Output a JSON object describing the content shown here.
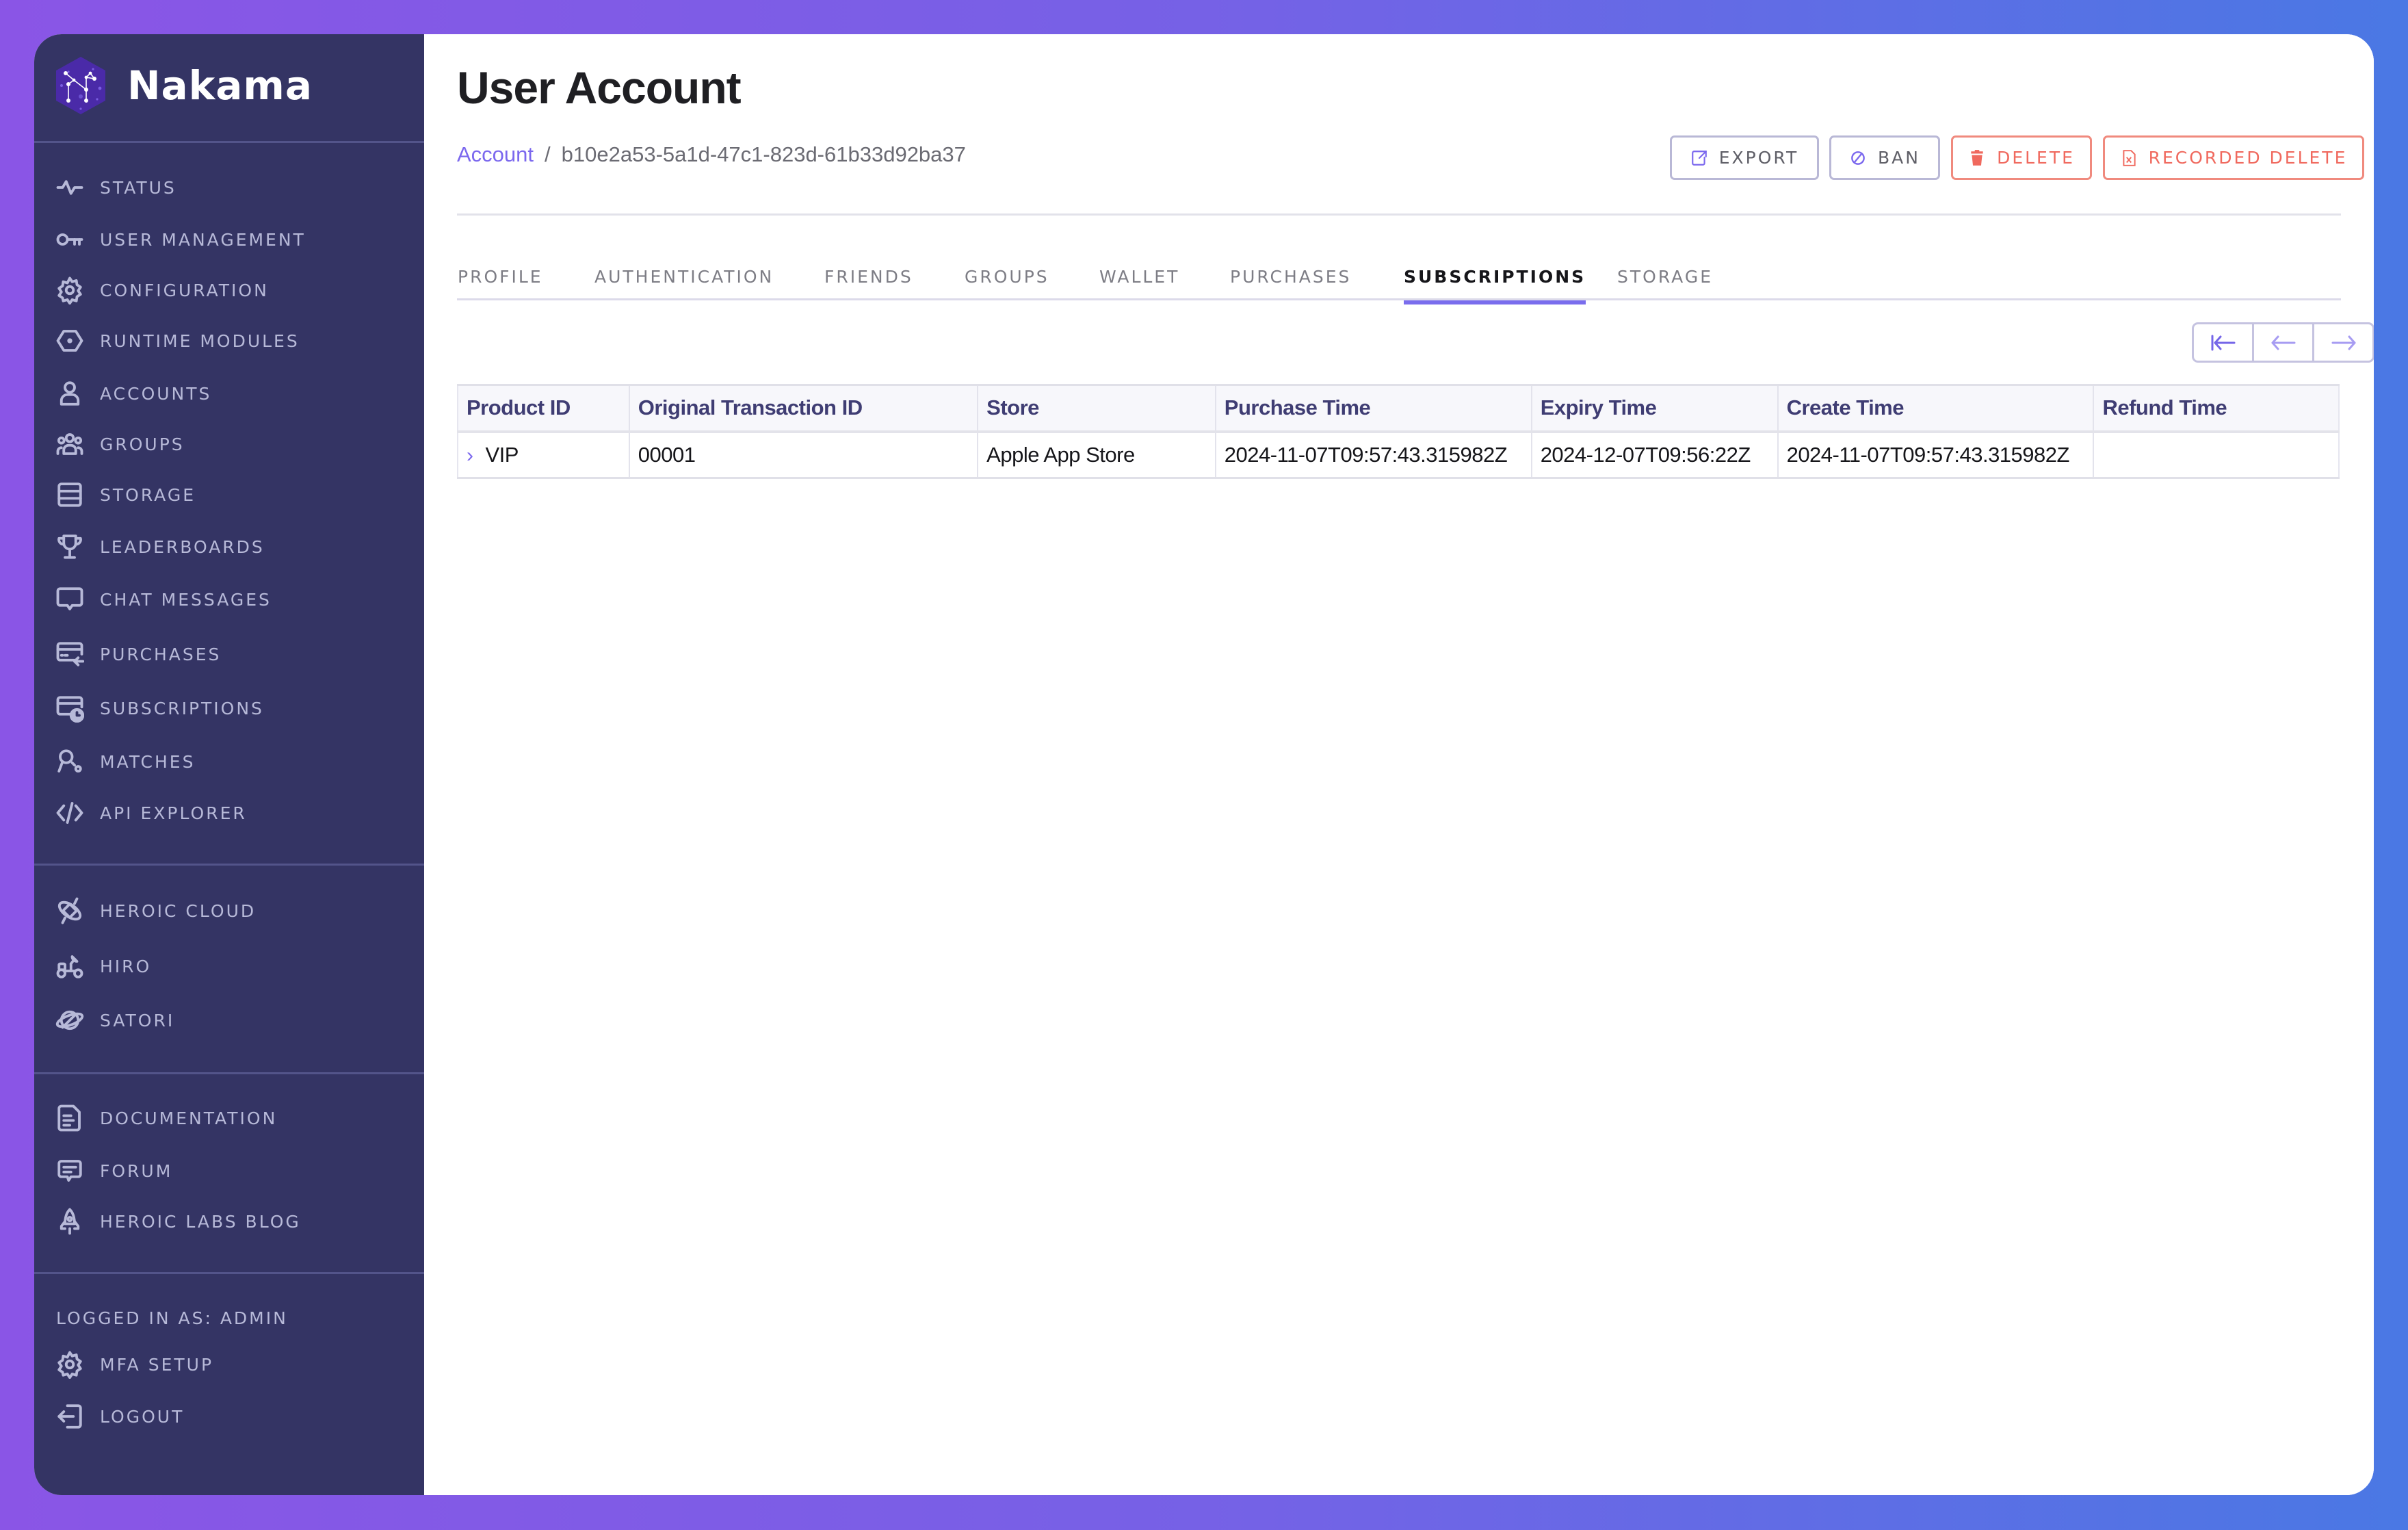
{
  "app": {
    "name": "Nakama"
  },
  "sidebar": {
    "primary": [
      {
        "label": "STATUS",
        "icon": "pulse-icon"
      },
      {
        "label": "USER MANAGEMENT",
        "icon": "key-icon"
      },
      {
        "label": "CONFIGURATION",
        "icon": "gear-icon"
      },
      {
        "label": "RUNTIME MODULES",
        "icon": "hexagon-icon"
      },
      {
        "label": "ACCOUNTS",
        "icon": "user-icon"
      },
      {
        "label": "GROUPS",
        "icon": "group-icon"
      },
      {
        "label": "STORAGE",
        "icon": "storage-icon"
      },
      {
        "label": "LEADERBOARDS",
        "icon": "trophy-icon"
      },
      {
        "label": "CHAT MESSAGES",
        "icon": "chat-icon"
      },
      {
        "label": "PURCHASES",
        "icon": "card-return-icon"
      },
      {
        "label": "SUBSCRIPTIONS",
        "icon": "card-clock-icon"
      },
      {
        "label": "MATCHES",
        "icon": "ping-pong-icon"
      },
      {
        "label": "API EXPLORER",
        "icon": "code-icon"
      }
    ],
    "products": [
      {
        "label": "HEROIC CLOUD",
        "icon": "satellite-icon"
      },
      {
        "label": "HIRO",
        "icon": "rover-icon"
      },
      {
        "label": "SATORI",
        "icon": "planet-rocket-icon"
      }
    ],
    "resources": [
      {
        "label": "DOCUMENTATION",
        "icon": "document-icon"
      },
      {
        "label": "FORUM",
        "icon": "forum-icon"
      },
      {
        "label": "HEROIC LABS BLOG",
        "icon": "rocket-icon"
      }
    ],
    "logged_in_as": "LOGGED IN AS: ADMIN",
    "account": [
      {
        "label": "MFA SETUP",
        "icon": "gear-icon"
      },
      {
        "label": "LOGOUT",
        "icon": "logout-icon"
      }
    ]
  },
  "header": {
    "title": "User Account",
    "breadcrumb": {
      "link": "Account",
      "separator": "/",
      "current": "b10e2a53-5a1d-47c1-823d-61b33d92ba37"
    },
    "actions": {
      "export": "EXPORT",
      "ban": "BAN",
      "delete": "DELETE",
      "recorded_delete": "RECORDED DELETE"
    }
  },
  "tabs": [
    {
      "label": "PROFILE",
      "active": false
    },
    {
      "label": "AUTHENTICATION",
      "active": false
    },
    {
      "label": "FRIENDS",
      "active": false
    },
    {
      "label": "GROUPS",
      "active": false
    },
    {
      "label": "WALLET",
      "active": false
    },
    {
      "label": "PURCHASES",
      "active": false
    },
    {
      "label": "SUBSCRIPTIONS",
      "active": true
    },
    {
      "label": "STORAGE",
      "active": false
    }
  ],
  "pagination": {
    "first": "first-page-icon",
    "prev": "previous-page-icon",
    "next": "next-page-icon"
  },
  "subscriptions_table": {
    "columns": [
      "Product ID",
      "Original Transaction ID",
      "Store",
      "Purchase Time",
      "Expiry Time",
      "Create Time",
      "Refund Time"
    ],
    "rows": [
      {
        "product_id": "VIP",
        "original_transaction_id": "00001",
        "store": "Apple App Store",
        "purchase_time": "2024-11-07T09:57:43.315982Z",
        "expiry_time": "2024-12-07T09:56:22Z",
        "create_time": "2024-11-07T09:57:43.315982Z",
        "refund_time": ""
      }
    ]
  },
  "colors": {
    "accent": "#7b68ee",
    "sidebar_bg": "#343464",
    "danger": "#f0695e"
  }
}
